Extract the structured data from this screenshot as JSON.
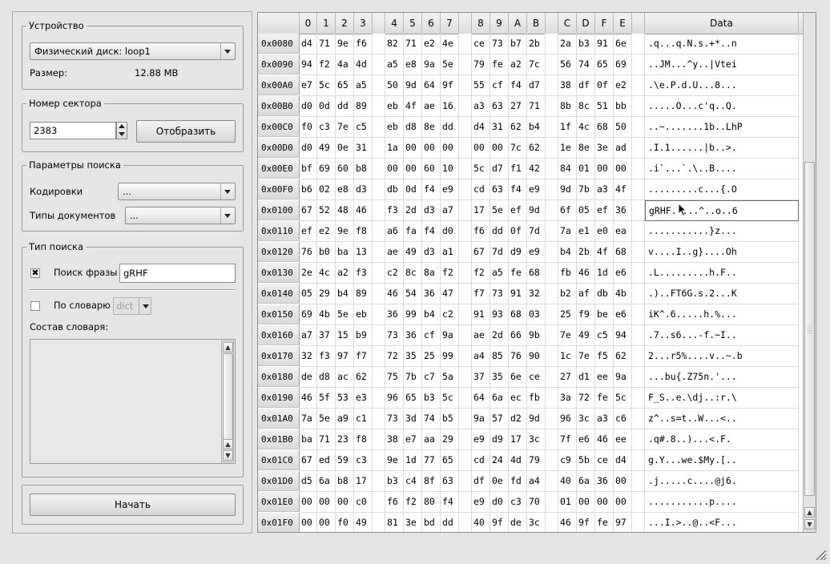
{
  "device": {
    "legend": "Устройство",
    "disk_value": "Физический диск: loop1",
    "size_label": "Размер:",
    "size_value": "12.88 MB"
  },
  "sector": {
    "legend": "Номер сектора",
    "value": "2383",
    "show_button": "Отобразить"
  },
  "search_params": {
    "legend": "Параметры поиска",
    "encodings_label": "Кодировки",
    "encodings_value": "...",
    "doctypes_label": "Типы документов",
    "doctypes_value": "..."
  },
  "search_type": {
    "legend": "Тип поиска",
    "phrase_label": "Поиск фразы",
    "phrase_checked": "✖",
    "phrase_value": "gRHF",
    "dict_label": "По словарю",
    "dict_value": "dict",
    "dict_contents_label": "Состав словаря:"
  },
  "start_button": "Начать",
  "hex": {
    "columns": [
      "0",
      "1",
      "2",
      "3",
      "",
      "4",
      "5",
      "6",
      "7",
      "",
      "8",
      "9",
      "A",
      "B",
      "",
      "C",
      "D",
      "F",
      "E",
      "",
      "Data"
    ],
    "selected_row": 8,
    "rows": [
      {
        "addr": "0x0080",
        "bytes": [
          "d4",
          "71",
          "9e",
          "f6",
          "",
          "82",
          "71",
          "e2",
          "4e",
          "",
          "ce",
          "73",
          "b7",
          "2b",
          "",
          "2a",
          "b3",
          "91",
          "6e",
          ""
        ],
        "data": ".q...q.N.s.+*..n"
      },
      {
        "addr": "0x0090",
        "bytes": [
          "94",
          "f2",
          "4a",
          "4d",
          "",
          "a5",
          "e8",
          "9a",
          "5e",
          "",
          "79",
          "fe",
          "a2",
          "7c",
          "",
          "56",
          "74",
          "65",
          "69",
          ""
        ],
        "data": "..JM...^y..|Vtei"
      },
      {
        "addr": "0x00A0",
        "bytes": [
          "e7",
          "5c",
          "65",
          "a5",
          "",
          "50",
          "9d",
          "64",
          "9f",
          "",
          "55",
          "cf",
          "f4",
          "d7",
          "",
          "38",
          "df",
          "0f",
          "e2",
          ""
        ],
        "data": ".\\e.P.d.U...8..."
      },
      {
        "addr": "0x00B0",
        "bytes": [
          "d0",
          "0d",
          "dd",
          "89",
          "",
          "eb",
          "4f",
          "ae",
          "16",
          "",
          "a3",
          "63",
          "27",
          "71",
          "",
          "8b",
          "8c",
          "51",
          "bb",
          ""
        ],
        "data": ".....O...c'q..Q."
      },
      {
        "addr": "0x00C0",
        "bytes": [
          "f0",
          "c3",
          "7e",
          "c5",
          "",
          "eb",
          "d8",
          "8e",
          "dd",
          "",
          "d4",
          "31",
          "62",
          "b4",
          "",
          "1f",
          "4c",
          "68",
          "50",
          ""
        ],
        "data": "..~.......1b..LhP"
      },
      {
        "addr": "0x00D0",
        "bytes": [
          "d0",
          "49",
          "0e",
          "31",
          "",
          "1a",
          "00",
          "00",
          "00",
          "",
          "00",
          "00",
          "7c",
          "62",
          "",
          "1e",
          "8e",
          "3e",
          "ad",
          ""
        ],
        "data": ".I.1......|b..>."
      },
      {
        "addr": "0x00E0",
        "bytes": [
          "bf",
          "69",
          "60",
          "b8",
          "",
          "00",
          "00",
          "60",
          "10",
          "",
          "5c",
          "d7",
          "f1",
          "42",
          "",
          "84",
          "01",
          "00",
          "00",
          ""
        ],
        "data": ".i`...`.\\..B...."
      },
      {
        "addr": "0x00F0",
        "bytes": [
          "b6",
          "02",
          "e8",
          "d3",
          "",
          "db",
          "0d",
          "f4",
          "e9",
          "",
          "cd",
          "63",
          "f4",
          "e9",
          "",
          "9d",
          "7b",
          "a3",
          "4f",
          ""
        ],
        "data": ".........c...{.O"
      },
      {
        "addr": "0x0100",
        "bytes": [
          "67",
          "52",
          "48",
          "46",
          "",
          "f3",
          "2d",
          "d3",
          "a7",
          "",
          "17",
          "5e",
          "ef",
          "9d",
          "",
          "6f",
          "05",
          "ef",
          "36",
          ""
        ],
        "data": "gRHF.-...^..o..6"
      },
      {
        "addr": "0x0110",
        "bytes": [
          "ef",
          "e2",
          "9e",
          "f8",
          "",
          "a6",
          "fa",
          "f4",
          "d0",
          "",
          "f6",
          "dd",
          "0f",
          "7d",
          "",
          "7a",
          "e1",
          "e0",
          "ea",
          ""
        ],
        "data": "...........}z..."
      },
      {
        "addr": "0x0120",
        "bytes": [
          "76",
          "b0",
          "ba",
          "13",
          "",
          "ae",
          "49",
          "d3",
          "a1",
          "",
          "67",
          "7d",
          "d9",
          "e9",
          "",
          "b4",
          "2b",
          "4f",
          "68",
          ""
        ],
        "data": "v....I..g}....Oh"
      },
      {
        "addr": "0x0130",
        "bytes": [
          "2e",
          "4c",
          "a2",
          "f3",
          "",
          "c2",
          "8c",
          "8a",
          "f2",
          "",
          "f2",
          "a5",
          "fe",
          "68",
          "",
          "fb",
          "46",
          "1d",
          "e6",
          ""
        ],
        "data": ".L.........h.F.."
      },
      {
        "addr": "0x0140",
        "bytes": [
          "05",
          "29",
          "b4",
          "89",
          "",
          "46",
          "54",
          "36",
          "47",
          "",
          "f7",
          "73",
          "91",
          "32",
          "",
          "b2",
          "af",
          "db",
          "4b",
          ""
        ],
        "data": ".)..FT6G.s.2...K"
      },
      {
        "addr": "0x0150",
        "bytes": [
          "69",
          "4b",
          "5e",
          "eb",
          "",
          "36",
          "99",
          "b4",
          "c2",
          "",
          "91",
          "93",
          "68",
          "03",
          "",
          "25",
          "f9",
          "be",
          "e6",
          ""
        ],
        "data": "iK^.6.....h.%..."
      },
      {
        "addr": "0x0160",
        "bytes": [
          "a7",
          "37",
          "15",
          "b9",
          "",
          "73",
          "36",
          "cf",
          "9a",
          "",
          "ae",
          "2d",
          "66",
          "9b",
          "",
          "7e",
          "49",
          "c5",
          "94",
          ""
        ],
        "data": ".7..s6...-f.~I.."
      },
      {
        "addr": "0x0170",
        "bytes": [
          "32",
          "f3",
          "97",
          "f7",
          "",
          "72",
          "35",
          "25",
          "99",
          "",
          "a4",
          "85",
          "76",
          "90",
          "",
          "1c",
          "7e",
          "f5",
          "62",
          ""
        ],
        "data": "2...r5%....v..~.b"
      },
      {
        "addr": "0x0180",
        "bytes": [
          "de",
          "d8",
          "ac",
          "62",
          "",
          "75",
          "7b",
          "c7",
          "5a",
          "",
          "37",
          "35",
          "6e",
          "ce",
          "",
          "27",
          "d1",
          "ee",
          "9a",
          ""
        ],
        "data": "...bu{.Z75n.'..."
      },
      {
        "addr": "0x0190",
        "bytes": [
          "46",
          "5f",
          "53",
          "e3",
          "",
          "96",
          "65",
          "b3",
          "5c",
          "",
          "64",
          "6a",
          "ec",
          "fb",
          "",
          "3a",
          "72",
          "fe",
          "5c",
          ""
        ],
        "data": "F_S..e.\\dj..:r.\\"
      },
      {
        "addr": "0x01A0",
        "bytes": [
          "7a",
          "5e",
          "a9",
          "c1",
          "",
          "73",
          "3d",
          "74",
          "b5",
          "",
          "9a",
          "57",
          "d2",
          "9d",
          "",
          "96",
          "3c",
          "a3",
          "c6",
          ""
        ],
        "data": "z^..s=t..W...<.."
      },
      {
        "addr": "0x01B0",
        "bytes": [
          "ba",
          "71",
          "23",
          "f8",
          "",
          "38",
          "e7",
          "aa",
          "29",
          "",
          "e9",
          "d9",
          "17",
          "3c",
          "",
          "7f",
          "e6",
          "46",
          "ee",
          ""
        ],
        "data": ".q#.8..)...<.F."
      },
      {
        "addr": "0x01C0",
        "bytes": [
          "67",
          "ed",
          "59",
          "c3",
          "",
          "9e",
          "1d",
          "77",
          "65",
          "",
          "cd",
          "24",
          "4d",
          "79",
          "",
          "c9",
          "5b",
          "ce",
          "d4",
          ""
        ],
        "data": "g.Y...we.$My.[.."
      },
      {
        "addr": "0x01D0",
        "bytes": [
          "d5",
          "6a",
          "b8",
          "17",
          "",
          "b3",
          "c4",
          "8f",
          "63",
          "",
          "df",
          "0e",
          "fd",
          "a4",
          "",
          "40",
          "6a",
          "36",
          "00",
          ""
        ],
        "data": ".j.....c....@j6."
      },
      {
        "addr": "0x01E0",
        "bytes": [
          "00",
          "00",
          "00",
          "c0",
          "",
          "f6",
          "f2",
          "80",
          "f4",
          "",
          "e9",
          "d0",
          "c3",
          "70",
          "",
          "01",
          "00",
          "00",
          "00",
          ""
        ],
        "data": "...........p...."
      },
      {
        "addr": "0x01F0",
        "bytes": [
          "00",
          "00",
          "f0",
          "49",
          "",
          "81",
          "3e",
          "bd",
          "dd",
          "",
          "40",
          "9f",
          "de",
          "3c",
          "",
          "46",
          "9f",
          "fe",
          "97",
          ""
        ],
        "data": "...I.>..@..<F..."
      }
    ]
  }
}
